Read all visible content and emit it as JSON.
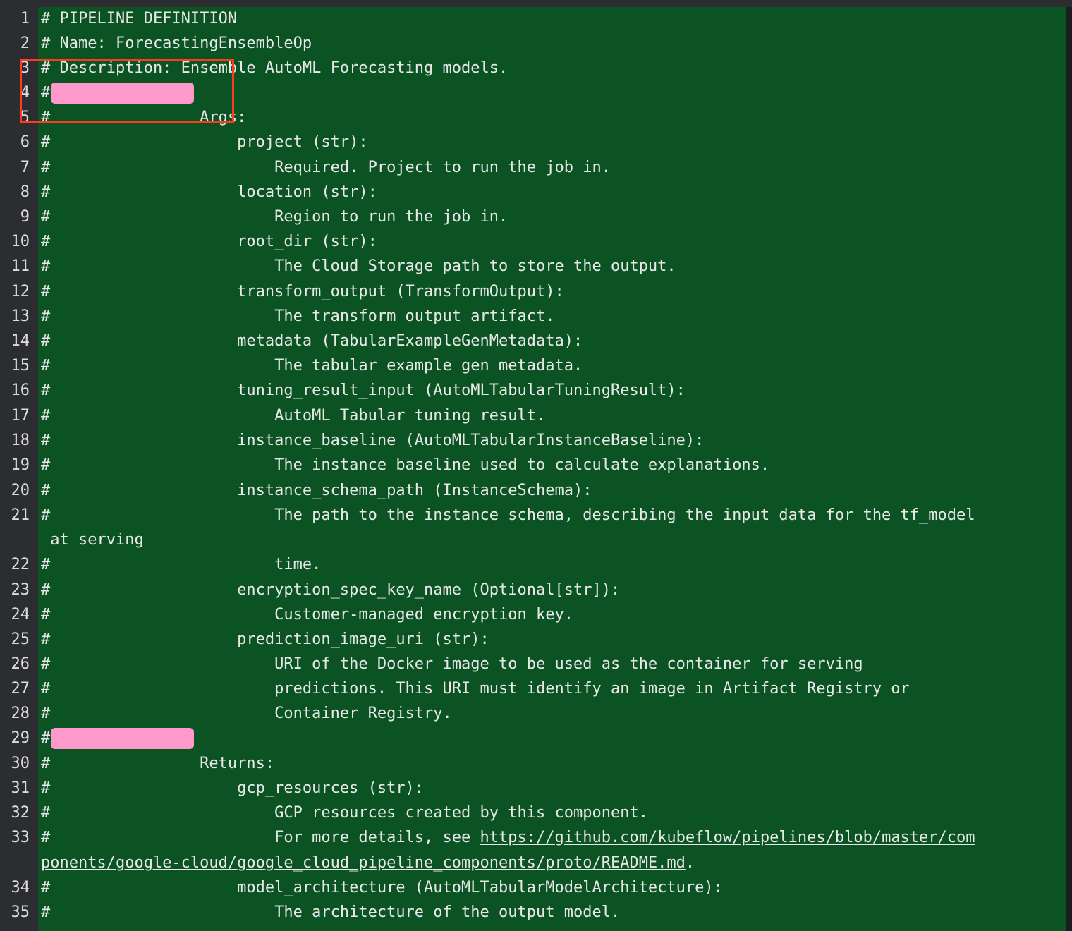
{
  "colors": {
    "editor_bg": "#0b5322",
    "gutter_bg": "#2b2d30",
    "text": "#e8e8e8",
    "redaction": "#ff99cc",
    "annotation_box": "#ff3b1f"
  },
  "lines": [
    {
      "num": "1",
      "text": "# PIPELINE DEFINITION"
    },
    {
      "num": "2",
      "text": "# Name: ForecastingEnsembleOp"
    },
    {
      "num": "3",
      "text": "# Description: Ensemble AutoML Forecasting models."
    },
    {
      "num": "4",
      "text": "#"
    },
    {
      "num": "5",
      "text": "#                Args:"
    },
    {
      "num": "6",
      "text": "#                    project (str):"
    },
    {
      "num": "7",
      "text": "#                        Required. Project to run the job in."
    },
    {
      "num": "8",
      "text": "#                    location (str):"
    },
    {
      "num": "9",
      "text": "#                        Region to run the job in."
    },
    {
      "num": "10",
      "text": "#                    root_dir (str):"
    },
    {
      "num": "11",
      "text": "#                        The Cloud Storage path to store the output."
    },
    {
      "num": "12",
      "text": "#                    transform_output (TransformOutput):"
    },
    {
      "num": "13",
      "text": "#                        The transform output artifact."
    },
    {
      "num": "14",
      "text": "#                    metadata (TabularExampleGenMetadata):"
    },
    {
      "num": "15",
      "text": "#                        The tabular example gen metadata."
    },
    {
      "num": "16",
      "text": "#                    tuning_result_input (AutoMLTabularTuningResult):"
    },
    {
      "num": "17",
      "text": "#                        AutoML Tabular tuning result."
    },
    {
      "num": "18",
      "text": "#                    instance_baseline (AutoMLTabularInstanceBaseline):"
    },
    {
      "num": "19",
      "text": "#                        The instance baseline used to calculate explanations."
    },
    {
      "num": "20",
      "text": "#                    instance_schema_path (InstanceSchema):"
    },
    {
      "num": "21",
      "text": "#                        The path to the instance schema, describing the input data for the tf_model"
    },
    {
      "num": "",
      "text": " at serving"
    },
    {
      "num": "22",
      "text": "#                        time."
    },
    {
      "num": "23",
      "text": "#                    encryption_spec_key_name (Optional[str]):"
    },
    {
      "num": "24",
      "text": "#                        Customer-managed encryption key."
    },
    {
      "num": "25",
      "text": "#                    prediction_image_uri (str):"
    },
    {
      "num": "26",
      "text": "#                        URI of the Docker image to be used as the container for serving"
    },
    {
      "num": "27",
      "text": "#                        predictions. This URI must identify an image in Artifact Registry or"
    },
    {
      "num": "28",
      "text": "#                        Container Registry."
    },
    {
      "num": "29",
      "text": "#"
    },
    {
      "num": "30",
      "text": "#                Returns:"
    },
    {
      "num": "31",
      "text": "#                    gcp_resources (str):"
    },
    {
      "num": "32",
      "text": "#                        GCP resources created by this component."
    },
    {
      "num": "33",
      "text": "#                        For more details, see ",
      "link": "https://github.com/kubeflow/pipelines/blob/master/com"
    },
    {
      "num": "",
      "text": "",
      "link": "ponents/google-cloud/google_cloud_pipeline_components/proto/README.md",
      "after": "."
    },
    {
      "num": "34",
      "text": "#                    model_architecture (AutoMLTabularModelArchitecture):"
    },
    {
      "num": "35",
      "text": "#                        The architecture of the output model."
    }
  ]
}
